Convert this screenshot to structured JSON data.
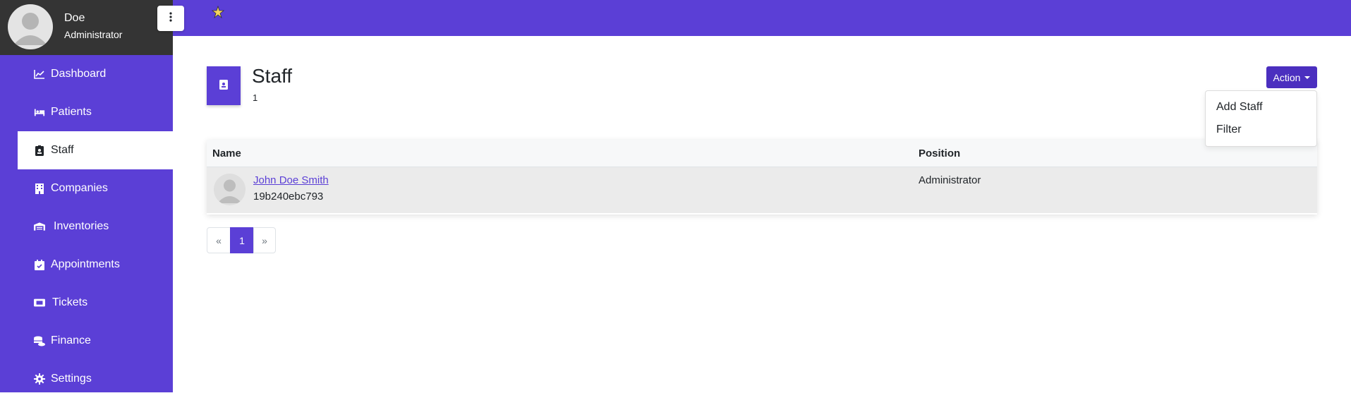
{
  "user": {
    "name": "Doe",
    "role": "Administrator"
  },
  "sidebar": {
    "items": [
      {
        "label": "Dashboard",
        "icon": "chart-line-icon"
      },
      {
        "label": "Patients",
        "icon": "bed-icon"
      },
      {
        "label": "Staff",
        "icon": "id-badge-icon",
        "active": true
      },
      {
        "label": "Companies",
        "icon": "building-icon"
      },
      {
        "label": "Inventories",
        "icon": "warehouse-icon"
      },
      {
        "label": "Appointments",
        "icon": "calendar-check-icon"
      },
      {
        "label": "Tickets",
        "icon": "ticket-icon"
      },
      {
        "label": "Finance",
        "icon": "coins-icon"
      },
      {
        "label": "Settings",
        "icon": "gear-icon"
      }
    ]
  },
  "header": {
    "title": "Staff",
    "count": "1"
  },
  "action": {
    "label": "Action",
    "menu": [
      "Add Staff",
      "Filter"
    ]
  },
  "table": {
    "columns": [
      "Name",
      "Position"
    ],
    "rows": [
      {
        "name": "John Doe Smith",
        "id": "19b240ebc793",
        "position": "Administrator"
      }
    ]
  },
  "pagination": {
    "prev": "«",
    "current": "1",
    "next": "»"
  },
  "colors": {
    "primary": "#5b3fd6",
    "user_box": "#343434",
    "action": "#4b2fbf"
  }
}
